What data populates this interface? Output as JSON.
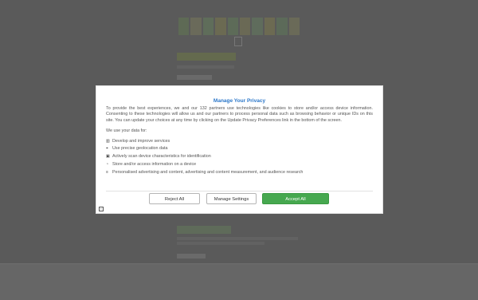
{
  "modal": {
    "title": "Manage Your Privacy",
    "intro": "To provide the best experiences, we and our 132 partners use technologies like cookies to store and/or access device information. Consenting to these technologies will allow us and our partners to process personal data such as browsing behavior or unique IDs on this site. You can update your choices at any time by clicking on the Update Privacy Preferences link in the bottom of the screen.",
    "use_label": "We use your data for:",
    "purposes": [
      {
        "icon": "chart-icon",
        "glyph": "▥",
        "label": "Develop and improve services"
      },
      {
        "icon": "location-pin-icon",
        "glyph": "⌖",
        "label": "Use precise geolocation data"
      },
      {
        "icon": "device-scan-icon",
        "glyph": "▣",
        "label": "Actively scan device characteristics for identification"
      },
      {
        "icon": "storage-icon",
        "glyph": "◔",
        "label": "Store and/or access information on a device"
      },
      {
        "icon": "ads-icon",
        "glyph": "≡",
        "label": "Personalised advertising and content, advertising and content measurement, and audience research"
      }
    ],
    "buttons": {
      "reject": "Reject All",
      "manage": "Manage Settings",
      "accept": "Accept All"
    }
  },
  "colors": {
    "overlay": "#5a5a5a",
    "accent": "#2b77c9",
    "accept": "#46a84f"
  }
}
